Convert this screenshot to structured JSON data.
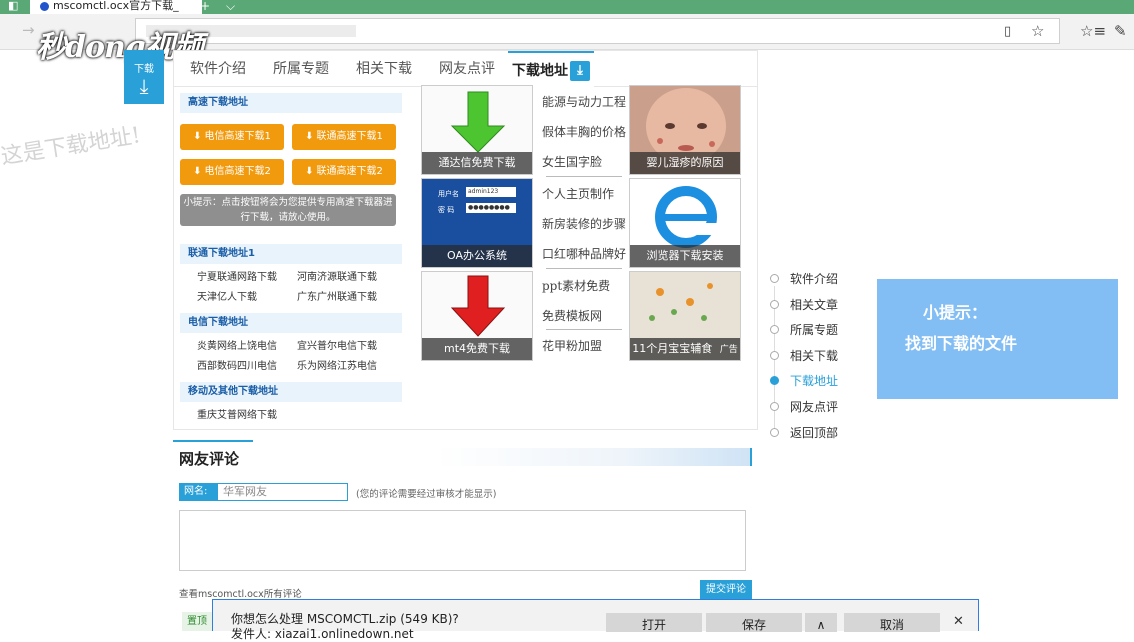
{
  "browser": {
    "tab_title": "mscomctl.ocx官方下载_",
    "new_tab": "+",
    "tab_menu": "⌵",
    "reading_icon": "reading-view-icon",
    "favorite_icon": "star-icon",
    "hub_icon": "favorites-hub-icon",
    "note_icon": "pen-icon"
  },
  "watermark": {
    "logo": "秒dong视频",
    "hand_note": "这是下载地址!"
  },
  "side_download": {
    "label": "下载",
    "icon": "download-arrow-icon"
  },
  "tabs": [
    {
      "label": "软件介绍"
    },
    {
      "label": "所属专题"
    },
    {
      "label": "相关下载"
    },
    {
      "label": "网友点评"
    },
    {
      "label": "下载地址",
      "active": true
    }
  ],
  "fast_download": {
    "heading": "高速下载地址",
    "buttons": [
      "电信高速下载1",
      "联通高速下载1",
      "电信高速下载2",
      "联通高速下载2"
    ],
    "tip": "小提示：点击按钮将会为您提供专用高速下载器进行下载，请放心使用。"
  },
  "unicom": {
    "heading": "联通下载地址1",
    "links": [
      "宁夏联通网路下载",
      "河南济源联通下载",
      "天津亿人下载",
      "广东广州联通下载"
    ]
  },
  "telecom": {
    "heading": "电信下载地址",
    "links": [
      "炎黄网络上饶电信",
      "宜兴普尔电信下载",
      "西部数码四川电信",
      "乐为网络江苏电信"
    ]
  },
  "mobile": {
    "heading": "移动及其他下载地址",
    "links": [
      "重庆艾普网络下载"
    ]
  },
  "ads": {
    "image_captions": [
      "通达信免费下载",
      "婴儿湿疹的原因",
      "OA办公系统",
      "浏览器下载安装",
      "mt4免费下载",
      "11个月宝宝辅食"
    ],
    "text_links": [
      "能源与动力工程",
      "假体丰胸的价格",
      "女生国字脸",
      "个人主页制作",
      "新房装修的步骤",
      "口红哪种品牌好",
      "ppt素材免费",
      "免费模板网",
      "花甲粉加盟"
    ],
    "ad_mark": "广告",
    "login_user_label": "用户名",
    "login_pass_label": "密  码",
    "login_user_value": "admin123",
    "login_pass_value": "●●●●●●●●"
  },
  "side_nav": {
    "items": [
      "软件介绍",
      "相关文章",
      "所属专题",
      "相关下载",
      "下载地址",
      "网友点评",
      "返回顶部"
    ],
    "active_index": 4
  },
  "hint_box": {
    "title": "小提示：",
    "body": "找到下载的文件"
  },
  "comments": {
    "title": "网友评论",
    "name_label": "网名:",
    "name_value": "华军网友",
    "note": "(您的评论需要经过审核才能显示)",
    "view_all": "查看mscomctl.ocx所有评论",
    "submit": "提交评论",
    "pin": "置顶"
  },
  "download_bar": {
    "question": "你想怎么处理 MSCOMCTL.zip (549 KB)?",
    "source": "发件人: xiazai1.onlinedown.net",
    "open": "打开",
    "save": "保存",
    "expand": "∧",
    "cancel": "取消",
    "close": "✕"
  }
}
